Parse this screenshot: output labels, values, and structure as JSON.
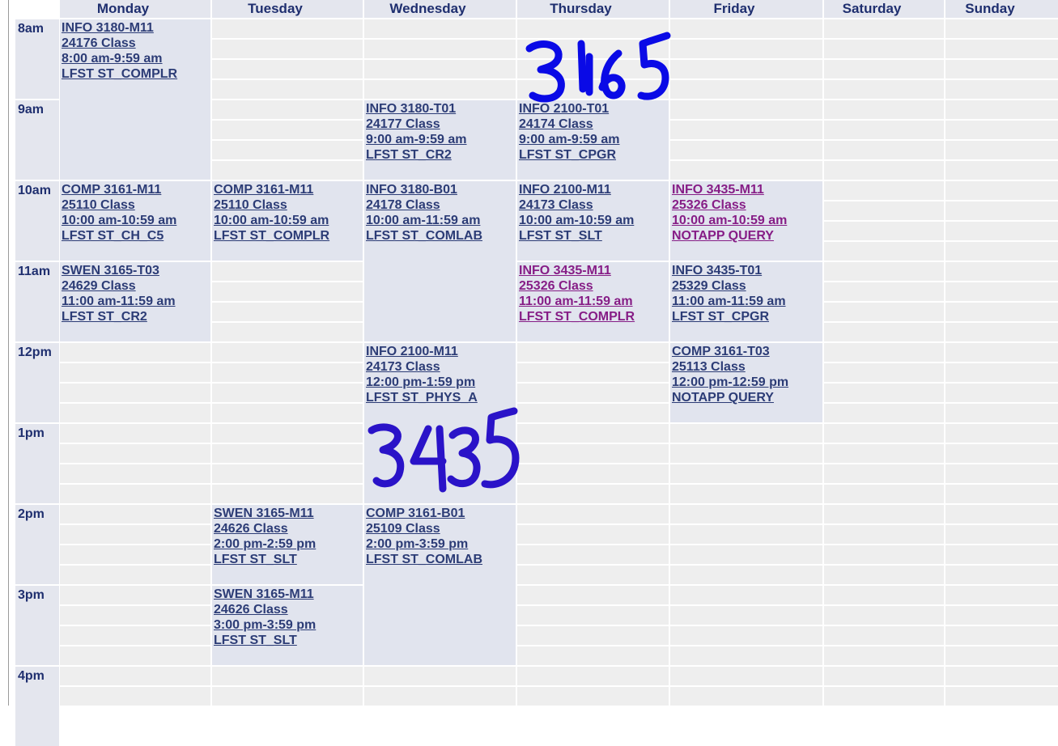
{
  "days": [
    "Monday",
    "Tuesday",
    "Wednesday",
    "Thursday",
    "Friday",
    "Saturday",
    "Sunday"
  ],
  "times": [
    "8am",
    "9am",
    "10am",
    "11am",
    "12pm",
    "1pm",
    "2pm",
    "3pm",
    "4pm"
  ],
  "events": [
    {
      "day": 0,
      "start": 0,
      "hours": 2,
      "lines": [
        "INFO 3180-M11",
        "24176 Class",
        "8:00 am-9:59 am",
        "LFST ST_COMPLR"
      ],
      "color": "navy"
    },
    {
      "day": 0,
      "start": 2,
      "hours": 1,
      "lines": [
        "COMP 3161-M11",
        "25110 Class",
        "10:00 am-10:59 am",
        "LFST ST_CH_C5"
      ],
      "color": "navy"
    },
    {
      "day": 0,
      "start": 3,
      "hours": 1,
      "lines": [
        "SWEN 3165-T03",
        "24629 Class",
        "11:00 am-11:59 am",
        "LFST ST_CR2"
      ],
      "color": "navy"
    },
    {
      "day": 1,
      "start": 2,
      "hours": 1,
      "lines": [
        "COMP 3161-M11",
        "25110 Class",
        "10:00 am-10:59 am",
        "LFST ST_COMPLR"
      ],
      "color": "navy"
    },
    {
      "day": 1,
      "start": 6,
      "hours": 1,
      "lines": [
        "SWEN 3165-M11",
        "24626 Class",
        "2:00 pm-2:59 pm",
        "LFST ST_SLT"
      ],
      "color": "navy"
    },
    {
      "day": 1,
      "start": 7,
      "hours": 1,
      "lines": [
        "SWEN 3165-M11",
        "24626 Class",
        "3:00 pm-3:59 pm",
        "LFST ST_SLT"
      ],
      "color": "navy"
    },
    {
      "day": 2,
      "start": 1,
      "hours": 1,
      "lines": [
        "INFO 3180-T01",
        "24177 Class",
        "9:00 am-9:59 am",
        "LFST ST_CR2"
      ],
      "color": "navy"
    },
    {
      "day": 2,
      "start": 2,
      "hours": 2,
      "lines": [
        "INFO 3180-B01",
        "24178 Class",
        "10:00 am-11:59 am",
        "LFST ST_COMLAB"
      ],
      "color": "navy"
    },
    {
      "day": 2,
      "start": 4,
      "hours": 2,
      "lines": [
        "INFO 2100-M11",
        "24173 Class",
        "12:00 pm-1:59 pm",
        "LFST ST_PHYS_A"
      ],
      "color": "navy"
    },
    {
      "day": 2,
      "start": 6,
      "hours": 2,
      "lines": [
        "COMP 3161-B01",
        "25109 Class",
        "2:00 pm-3:59 pm",
        "LFST ST_COMLAB"
      ],
      "color": "navy"
    },
    {
      "day": 3,
      "start": 1,
      "hours": 1,
      "lines": [
        "INFO 2100-T01",
        "24174 Class",
        "9:00 am-9:59 am",
        "LFST ST_CPGR"
      ],
      "color": "navy"
    },
    {
      "day": 3,
      "start": 2,
      "hours": 1,
      "lines": [
        "INFO 2100-M11",
        "24173 Class",
        "10:00 am-10:59 am",
        "LFST ST_SLT"
      ],
      "color": "navy"
    },
    {
      "day": 3,
      "start": 3,
      "hours": 1,
      "lines": [
        "INFO 3435-M11",
        "25326 Class",
        "11:00 am-11:59 am",
        "LFST ST_COMPLR"
      ],
      "color": "purple"
    },
    {
      "day": 4,
      "start": 2,
      "hours": 1,
      "lines": [
        "INFO 3435-M11",
        "25326 Class",
        "10:00 am-10:59 am",
        "NOTAPP QUERY"
      ],
      "color": "purple"
    },
    {
      "day": 4,
      "start": 3,
      "hours": 1,
      "lines": [
        "INFO 3435-T01",
        "25329 Class",
        "11:00 am-11:59 am",
        "LFST ST_CPGR"
      ],
      "color": "navy"
    },
    {
      "day": 4,
      "start": 4,
      "hours": 1,
      "lines": [
        "COMP 3161-T03",
        "25113 Class",
        "12:00 pm-12:59 pm",
        "NOTAPP QUERY"
      ],
      "color": "navy"
    }
  ],
  "annotations": [
    {
      "text": "3165",
      "color": "#0a0ae6"
    },
    {
      "text": "3435",
      "color": "#2a13c8"
    }
  ]
}
